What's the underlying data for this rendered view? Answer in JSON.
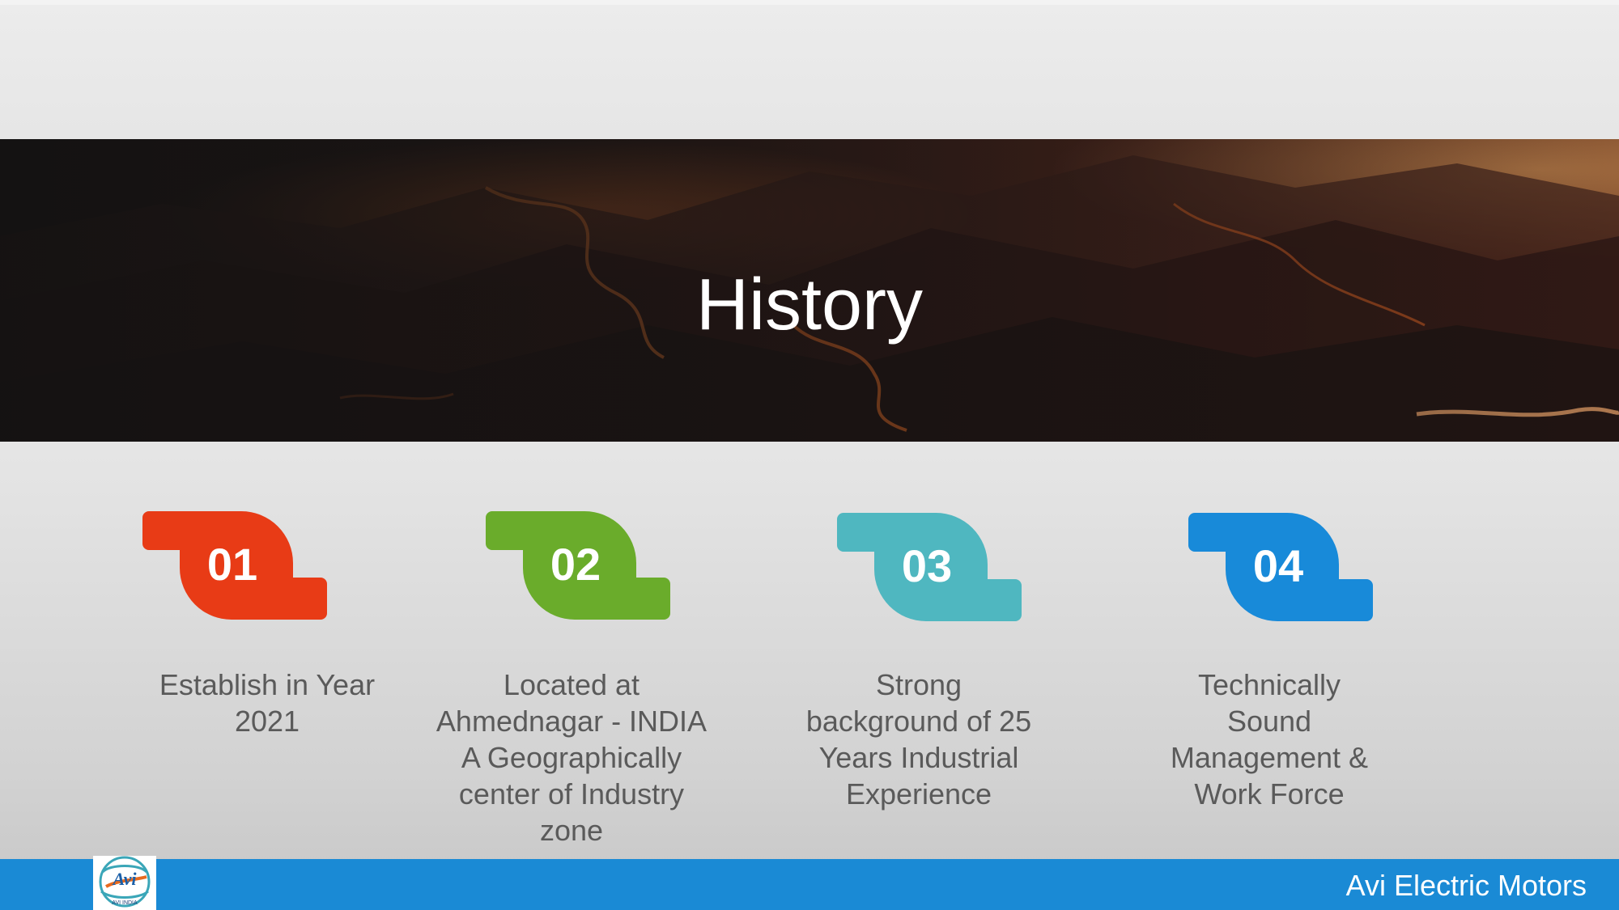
{
  "banner": {
    "title": "History"
  },
  "steps": [
    {
      "number": "01",
      "color": "#e83b16",
      "description_lines": [
        "Establish in Year",
        "2021"
      ]
    },
    {
      "number": "02",
      "color": "#6aac2b",
      "description_lines": [
        "Located at",
        "Ahmednagar - INDIA",
        "A Geographically",
        "center of Industry",
        "zone"
      ]
    },
    {
      "number": "03",
      "color": "#4fb7c0",
      "description_lines": [
        "Strong",
        "background of 25",
        "Years Industrial",
        "Experience"
      ]
    },
    {
      "number": "04",
      "color": "#188ad9",
      "description_lines": [
        "Technically",
        "Sound",
        "Management &",
        "Work Force"
      ]
    }
  ],
  "footer": {
    "company": "Avi Electric Motors",
    "color": "#1a8ad5",
    "logo_text": "Avi",
    "logo_subtext": "AVI INDIA"
  }
}
